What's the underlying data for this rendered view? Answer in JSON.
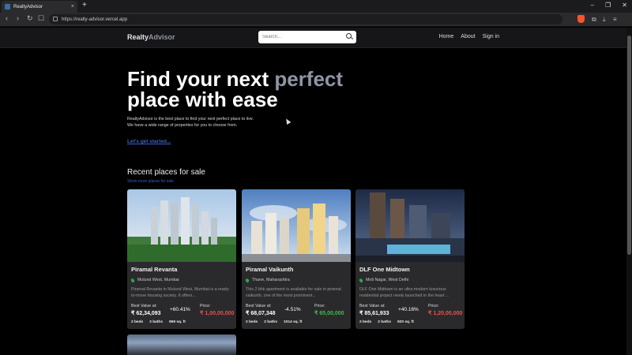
{
  "browser": {
    "tab_title": "RealtyAdvisor",
    "url": "https://realty-advisor.vercel.app",
    "new_tab": "+",
    "tab_close": "×",
    "win_min": "–",
    "win_max": "❐",
    "win_close": "✕",
    "back": "‹",
    "forward": "›",
    "reload": "↻",
    "bookmark": "☐"
  },
  "nav": {
    "brand_part1": "Realty",
    "brand_part2": "Advisor",
    "search_placeholder": "Search...",
    "links": [
      "Home",
      "About",
      "Sign in"
    ]
  },
  "hero": {
    "title_line1": "Find your next ",
    "title_accent": "perfect",
    "title_line2": "place with ease",
    "desc_line1": "RealtyAdvisor is the best place to find your next perfect place to live.",
    "desc_line2": "We have a wide range of properties for you to choose from.",
    "cta": "Let's get started..."
  },
  "recent": {
    "title": "Recent places for sale",
    "show_more": "Show more places for sale"
  },
  "cards": [
    {
      "title": "Piramal Revanta",
      "location": "Mulund West, Mumbai",
      "desc": "Piramal Revanta in Mulund West, Mumbai is a ready-to-move housing society. It offers...",
      "best_value_label": "Best Value at:",
      "best_value": "₹ 62,34,093",
      "change": "+60.41%",
      "price_label": "Price:",
      "price": "₹ 1,00,00,000",
      "price_color": "#e5534b",
      "beds": "2 beds",
      "baths": "2 baths",
      "area": "969 sq. ft"
    },
    {
      "title": "Piramal Vaikunth",
      "location": "Thane, Maharashtra",
      "desc": "This 2 bhk apartment is available for sale in piramal vaikunth, one of the most prominent...",
      "best_value_label": "Best Value at:",
      "best_value": "₹ 68,07,348",
      "change": "-4.51%",
      "price_label": "Price:",
      "price": "₹ 65,00,000",
      "price_color": "#3fb950",
      "beds": "2 beds",
      "baths": "2 baths",
      "area": "1014 sq. ft"
    },
    {
      "title": "DLF One Midtown",
      "location": "Moti Nagar, West Delhi",
      "desc": "DLF One Midtown is an ultra-modern luxurious residential project newly launched in the heart ...",
      "best_value_label": "Best Value at:",
      "best_value": "₹ 85,61,933",
      "change": "+40.16%",
      "price_label": "Price:",
      "price": "₹ 1,20,00,000",
      "price_color": "#e5534b",
      "beds": "2 beds",
      "baths": "2 baths",
      "area": "920 sq. ft"
    }
  ]
}
